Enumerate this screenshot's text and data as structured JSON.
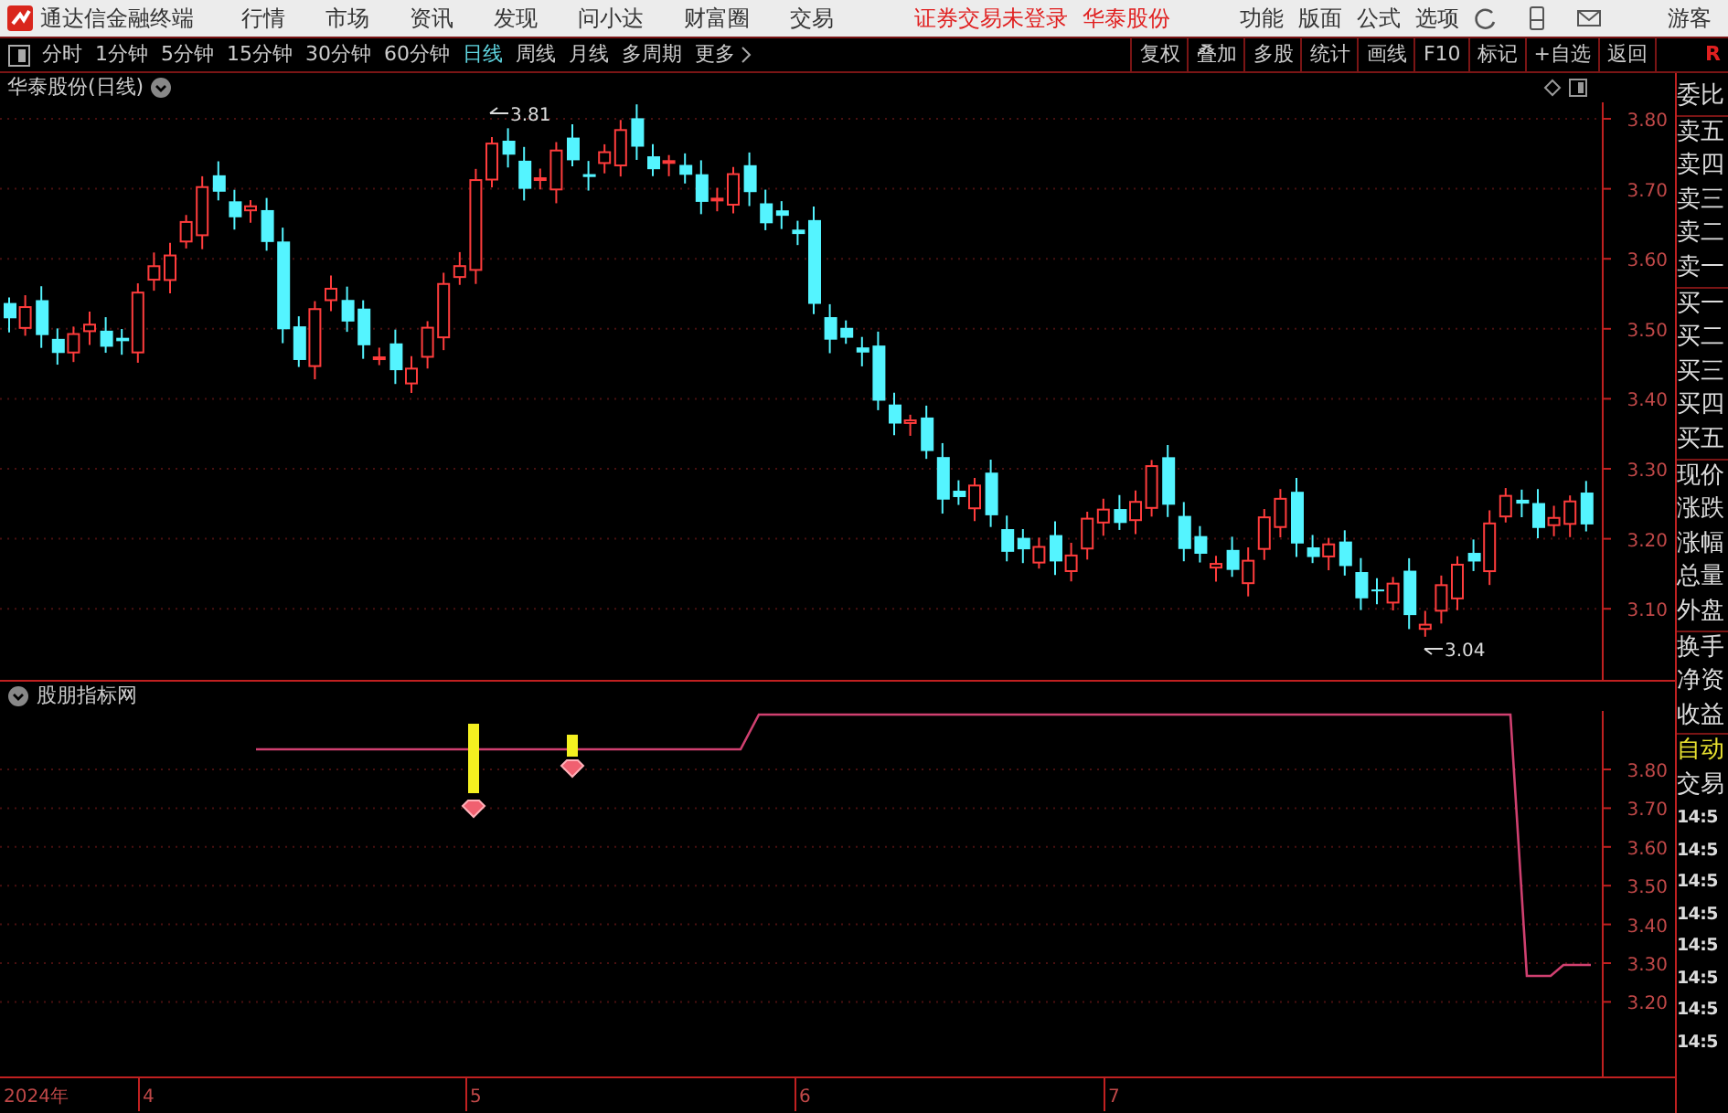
{
  "app": {
    "title": "通达信金融终端"
  },
  "menu": [
    "行情",
    "市场",
    "资讯",
    "发现",
    "问小达",
    "财富圈",
    "交易"
  ],
  "login_status": "证券交易未登录",
  "stock_link": "华泰股份",
  "right_menu": [
    "功能",
    "版面",
    "公式",
    "选项"
  ],
  "user": "游客",
  "periods": [
    {
      "label": "分时",
      "selected": false
    },
    {
      "label": "1分钟",
      "selected": false
    },
    {
      "label": "5分钟",
      "selected": false
    },
    {
      "label": "15分钟",
      "selected": false
    },
    {
      "label": "30分钟",
      "selected": false
    },
    {
      "label": "60分钟",
      "selected": false
    },
    {
      "label": "日线",
      "selected": true
    },
    {
      "label": "周线",
      "selected": false
    },
    {
      "label": "月线",
      "selected": false
    },
    {
      "label": "多周期",
      "selected": false
    },
    {
      "label": "更多",
      "selected": false
    }
  ],
  "tools": [
    "复权",
    "叠加",
    "多股",
    "统计",
    "画线",
    "F10",
    "标记",
    "+自选",
    "返回"
  ],
  "realtime_flag": "R",
  "main_chart": {
    "title": "华泰股份(日线)",
    "yticks": [
      "3.80",
      "3.70",
      "3.60",
      "3.50",
      "3.40",
      "3.30",
      "3.20",
      "3.10"
    ],
    "high_label": "3.81",
    "low_label": "3.04"
  },
  "indicator": {
    "title": "股朋指标网",
    "yticks": [
      "3.80",
      "3.70",
      "3.60",
      "3.50",
      "3.40",
      "3.30",
      "3.20"
    ]
  },
  "x_axis": [
    "2024年",
    "4",
    "5",
    "6",
    "7"
  ],
  "quote_panel": {
    "groups": [
      [
        "委比"
      ],
      [
        "卖五",
        "卖四",
        "卖三",
        "卖二",
        "卖一"
      ],
      [
        "买一",
        "买二",
        "买三",
        "买四",
        "买五"
      ],
      [
        "现价",
        "涨跌",
        "涨幅",
        "总量",
        "外盘"
      ],
      [
        "换手",
        "净资",
        "收益"
      ]
    ],
    "auto_label": "自动",
    "trade_label": "交易",
    "times": [
      "14:5",
      "14:5",
      "14:5",
      "14:5",
      "14:5",
      "14:5",
      "14:5",
      "14:5"
    ]
  }
}
